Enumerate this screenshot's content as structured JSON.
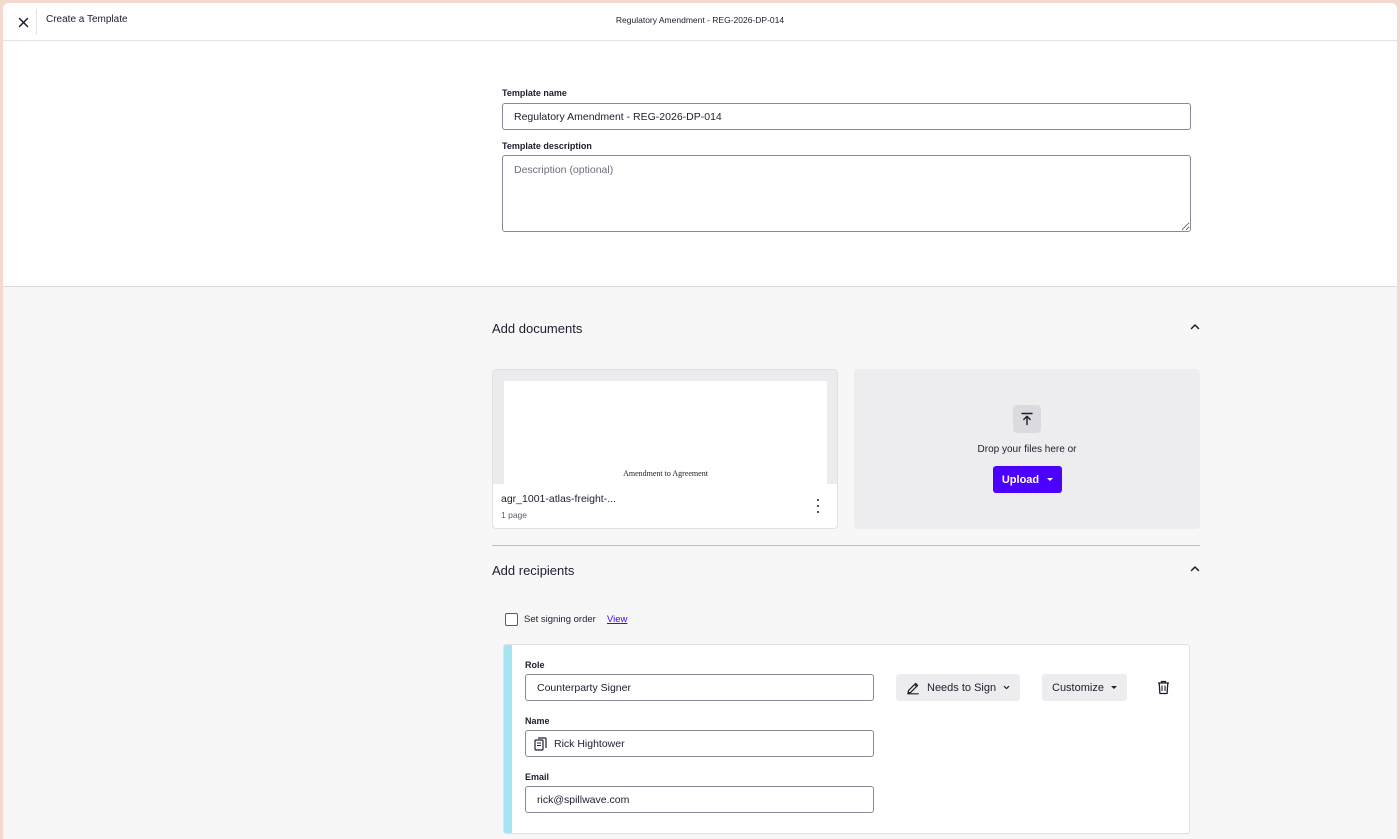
{
  "header": {
    "app_title": "Create a Template",
    "document_title": "Regulatory Amendment - REG-2026-DP-014"
  },
  "template_form": {
    "name_label": "Template name",
    "name_value": "Regulatory Amendment - REG-2026-DP-014",
    "description_label": "Template description",
    "description_placeholder": "Description (optional)"
  },
  "documents": {
    "section_title": "Add documents",
    "items": [
      {
        "thumbnail_text": "Amendment to Agreement",
        "name": "agr_1001-atlas-freight-...",
        "pages": "1 page"
      }
    ],
    "drop_text": "Drop your files here or",
    "upload_label": "Upload"
  },
  "recipients": {
    "section_title": "Add recipients",
    "signing_order_label": "Set signing order",
    "signing_order_checked": false,
    "view_link": "View",
    "items": [
      {
        "role_label": "Role",
        "role_value": "Counterparty Signer",
        "name_label": "Name",
        "name_value": "Rick Hightower",
        "email_label": "Email",
        "email_value": "rick@spillwave.com",
        "action_label": "Needs to Sign",
        "customize_label": "Customize",
        "accent_color": "#a5e4f2"
      }
    ]
  },
  "colors": {
    "primary": "#4c00ff",
    "text": "#1f1c2e",
    "window_border": "#f3d9cf"
  }
}
